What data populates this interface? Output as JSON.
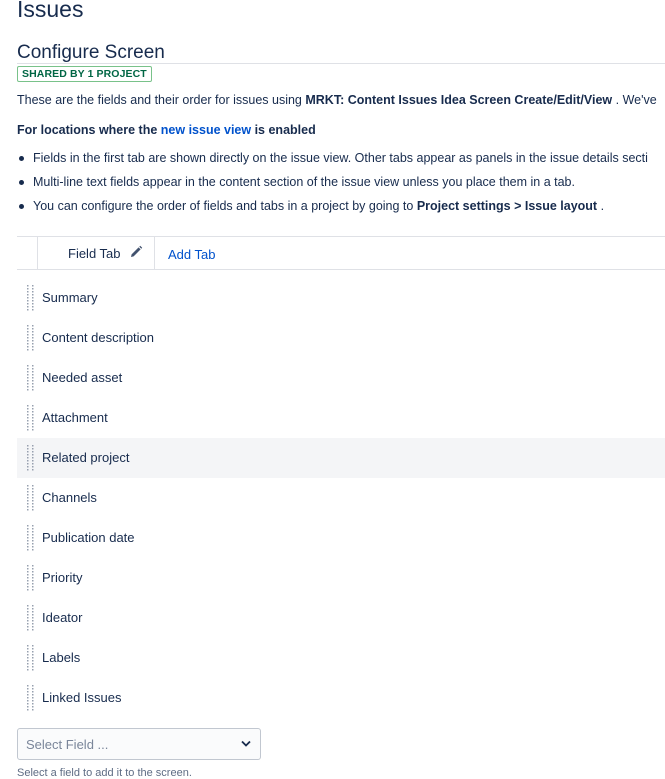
{
  "page": {
    "title": "Issues"
  },
  "screen": {
    "title": "Configure Screen",
    "shared_badge": "SHARED BY 1 PROJECT",
    "intro_prefix": "These are the fields and their order for issues using ",
    "intro_screen_name": "MRKT: Content Issues Idea Screen Create/Edit/View",
    "intro_suffix": " . We've"
  },
  "new_issue_view": {
    "heading_prefix": "For locations where the ",
    "heading_link": "new issue view",
    "heading_suffix": " is enabled",
    "bullets": [
      "Fields in the first tab are shown directly on the issue view. Other tabs appear as panels in the issue details secti",
      "Multi-line text fields appear in the content section of the issue view unless you place them in a tab."
    ],
    "bullet3_prefix": "You can configure the order of fields and tabs in a project by going to ",
    "bullet3_bold": "Project settings > Issue layout",
    "bullet3_suffix": " ."
  },
  "tabs": {
    "active_label": "Field Tab",
    "add_label": "Add Tab"
  },
  "fields": [
    "Summary",
    "Content description",
    "Needed asset",
    "Attachment",
    "Related project",
    "Channels",
    "Publication date",
    "Priority",
    "Ideator",
    "Labels",
    "Linked Issues"
  ],
  "hovered_field_index": 4,
  "select_field": {
    "placeholder": "Select Field ...",
    "hint": "Select a field to add it to the screen."
  },
  "colors": {
    "text": "#172b4d",
    "link": "#0052cc",
    "badge_border": "#79c28a",
    "badge_text": "#006644",
    "hover_row": "#f4f5f7"
  },
  "icons": {
    "edit_tab": "pencil-icon",
    "drag": "drag-handle-icon",
    "select": "chevron-down-icon"
  }
}
